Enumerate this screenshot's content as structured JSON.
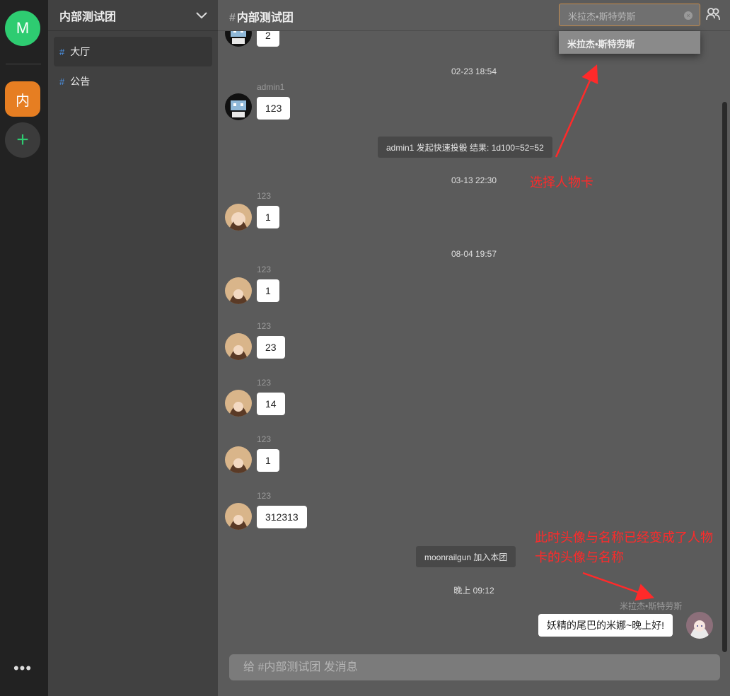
{
  "rail": {
    "user_initial": "M",
    "group_initial": "内",
    "add_symbol": "+",
    "more_symbol": "•••"
  },
  "sidebar": {
    "group_name": "内部测试团",
    "channels": [
      {
        "label": "大厅",
        "active": true
      },
      {
        "label": "公告",
        "active": false
      }
    ]
  },
  "main": {
    "channel_title": "内部测试团",
    "hash": "#",
    "role_select": {
      "value": "米拉杰•斯特劳斯",
      "clear_icon": "×"
    },
    "role_options": [
      "米拉杰•斯特劳斯"
    ],
    "messages": [
      {
        "sender": "",
        "text": "2"
      },
      {
        "timestamp": "02-23 18:54"
      },
      {
        "sender": "admin1",
        "text": "123"
      },
      {
        "system": "admin1 发起快速投骰 结果: 1d100=52=52"
      },
      {
        "timestamp": "03-13 22:30"
      },
      {
        "sender": "123",
        "text": "1"
      },
      {
        "timestamp": "08-04 19:57"
      },
      {
        "sender": "123",
        "text": "1"
      },
      {
        "sender": "123",
        "text": "23"
      },
      {
        "sender": "123",
        "text": "14"
      },
      {
        "sender": "123",
        "text": "1"
      },
      {
        "sender": "123",
        "text": "312313"
      },
      {
        "system": "moonrailgun 加入本团"
      },
      {
        "timestamp": "晚上 09:12"
      },
      {
        "sender": "米拉杰•斯特劳斯",
        "text": "妖精的尾巴的米娜~晚上好!",
        "self": true
      }
    ],
    "composer_placeholder": "给 #内部测试团 发消息"
  },
  "annotations": {
    "select_card": "选择人物卡",
    "avatar_changed_line1": "此时头像与名称已经变成了人物",
    "avatar_changed_line2": "卡的头像与名称"
  },
  "colors": {
    "user_avatar": "#2ecc71",
    "group_avatar": "#e67e22",
    "annotation": "#ff2a2a",
    "hash_accent": "#4a90e2"
  }
}
